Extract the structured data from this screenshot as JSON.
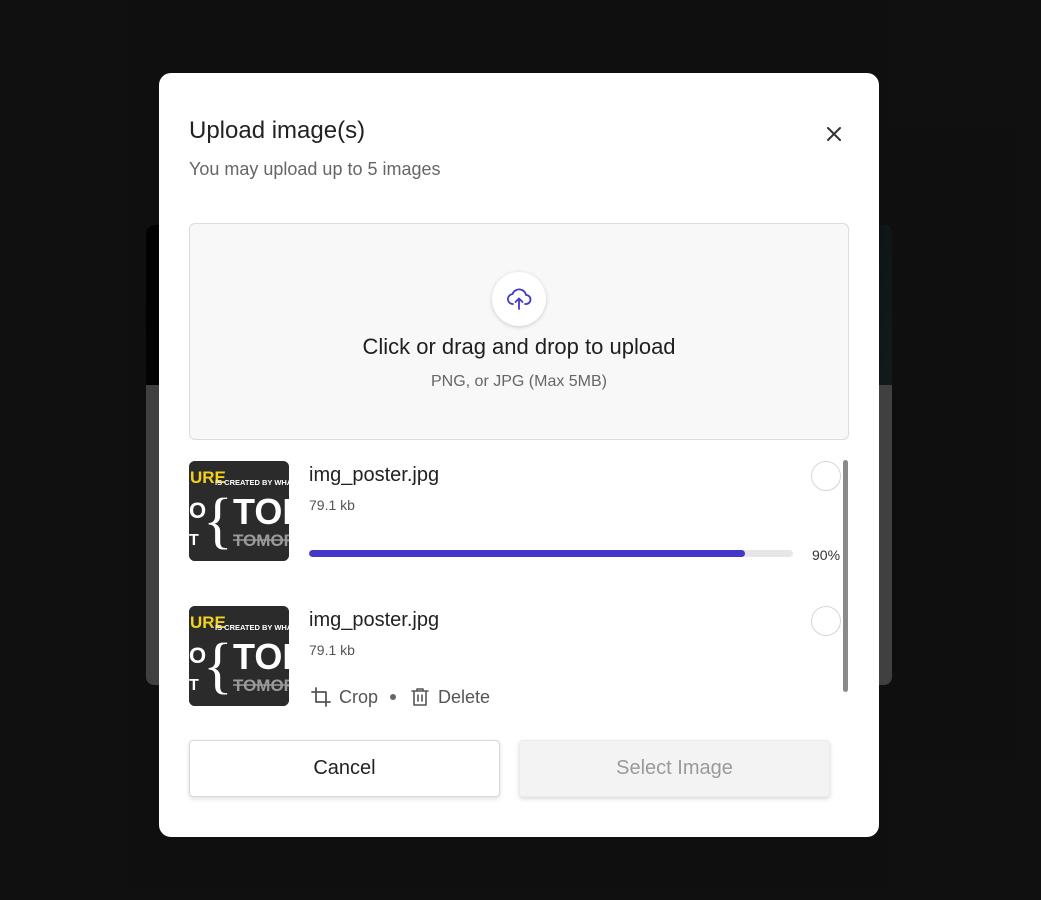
{
  "modal": {
    "title": "Upload image(s)",
    "subtitle": "You may upload up to 5 images",
    "close_icon": "close-icon"
  },
  "dropzone": {
    "icon": "cloud-upload-icon",
    "title": "Click or drag and drop to upload",
    "hint": "PNG, or JPG (Max 5MB)"
  },
  "files": [
    {
      "name": "img_poster.jpg",
      "size": "79.1 kb",
      "status": "uploading",
      "progress": 0.9,
      "progress_label": "90%",
      "thumbnail_text": {
        "a": "URE",
        "b": "IS CREATED BY WHAT",
        "c": "O",
        "d": "TOD",
        "e": "T",
        "f": "TOMORR"
      }
    },
    {
      "name": "img_poster.jpg",
      "size": "79.1 kb",
      "status": "uploaded",
      "thumbnail_text": {
        "a": "URE",
        "b": "IS CREATED BY WHAT",
        "c": "O",
        "d": "TOD",
        "e": "T",
        "f": "TOMORR"
      },
      "actions": {
        "crop": "Crop",
        "delete": "Delete"
      }
    }
  ],
  "footer": {
    "cancel": "Cancel",
    "select": "Select Image"
  },
  "colors": {
    "accent": "#4338ca",
    "overlay": "#3f3f3f",
    "thumb_yellow": "#f2d21b"
  }
}
